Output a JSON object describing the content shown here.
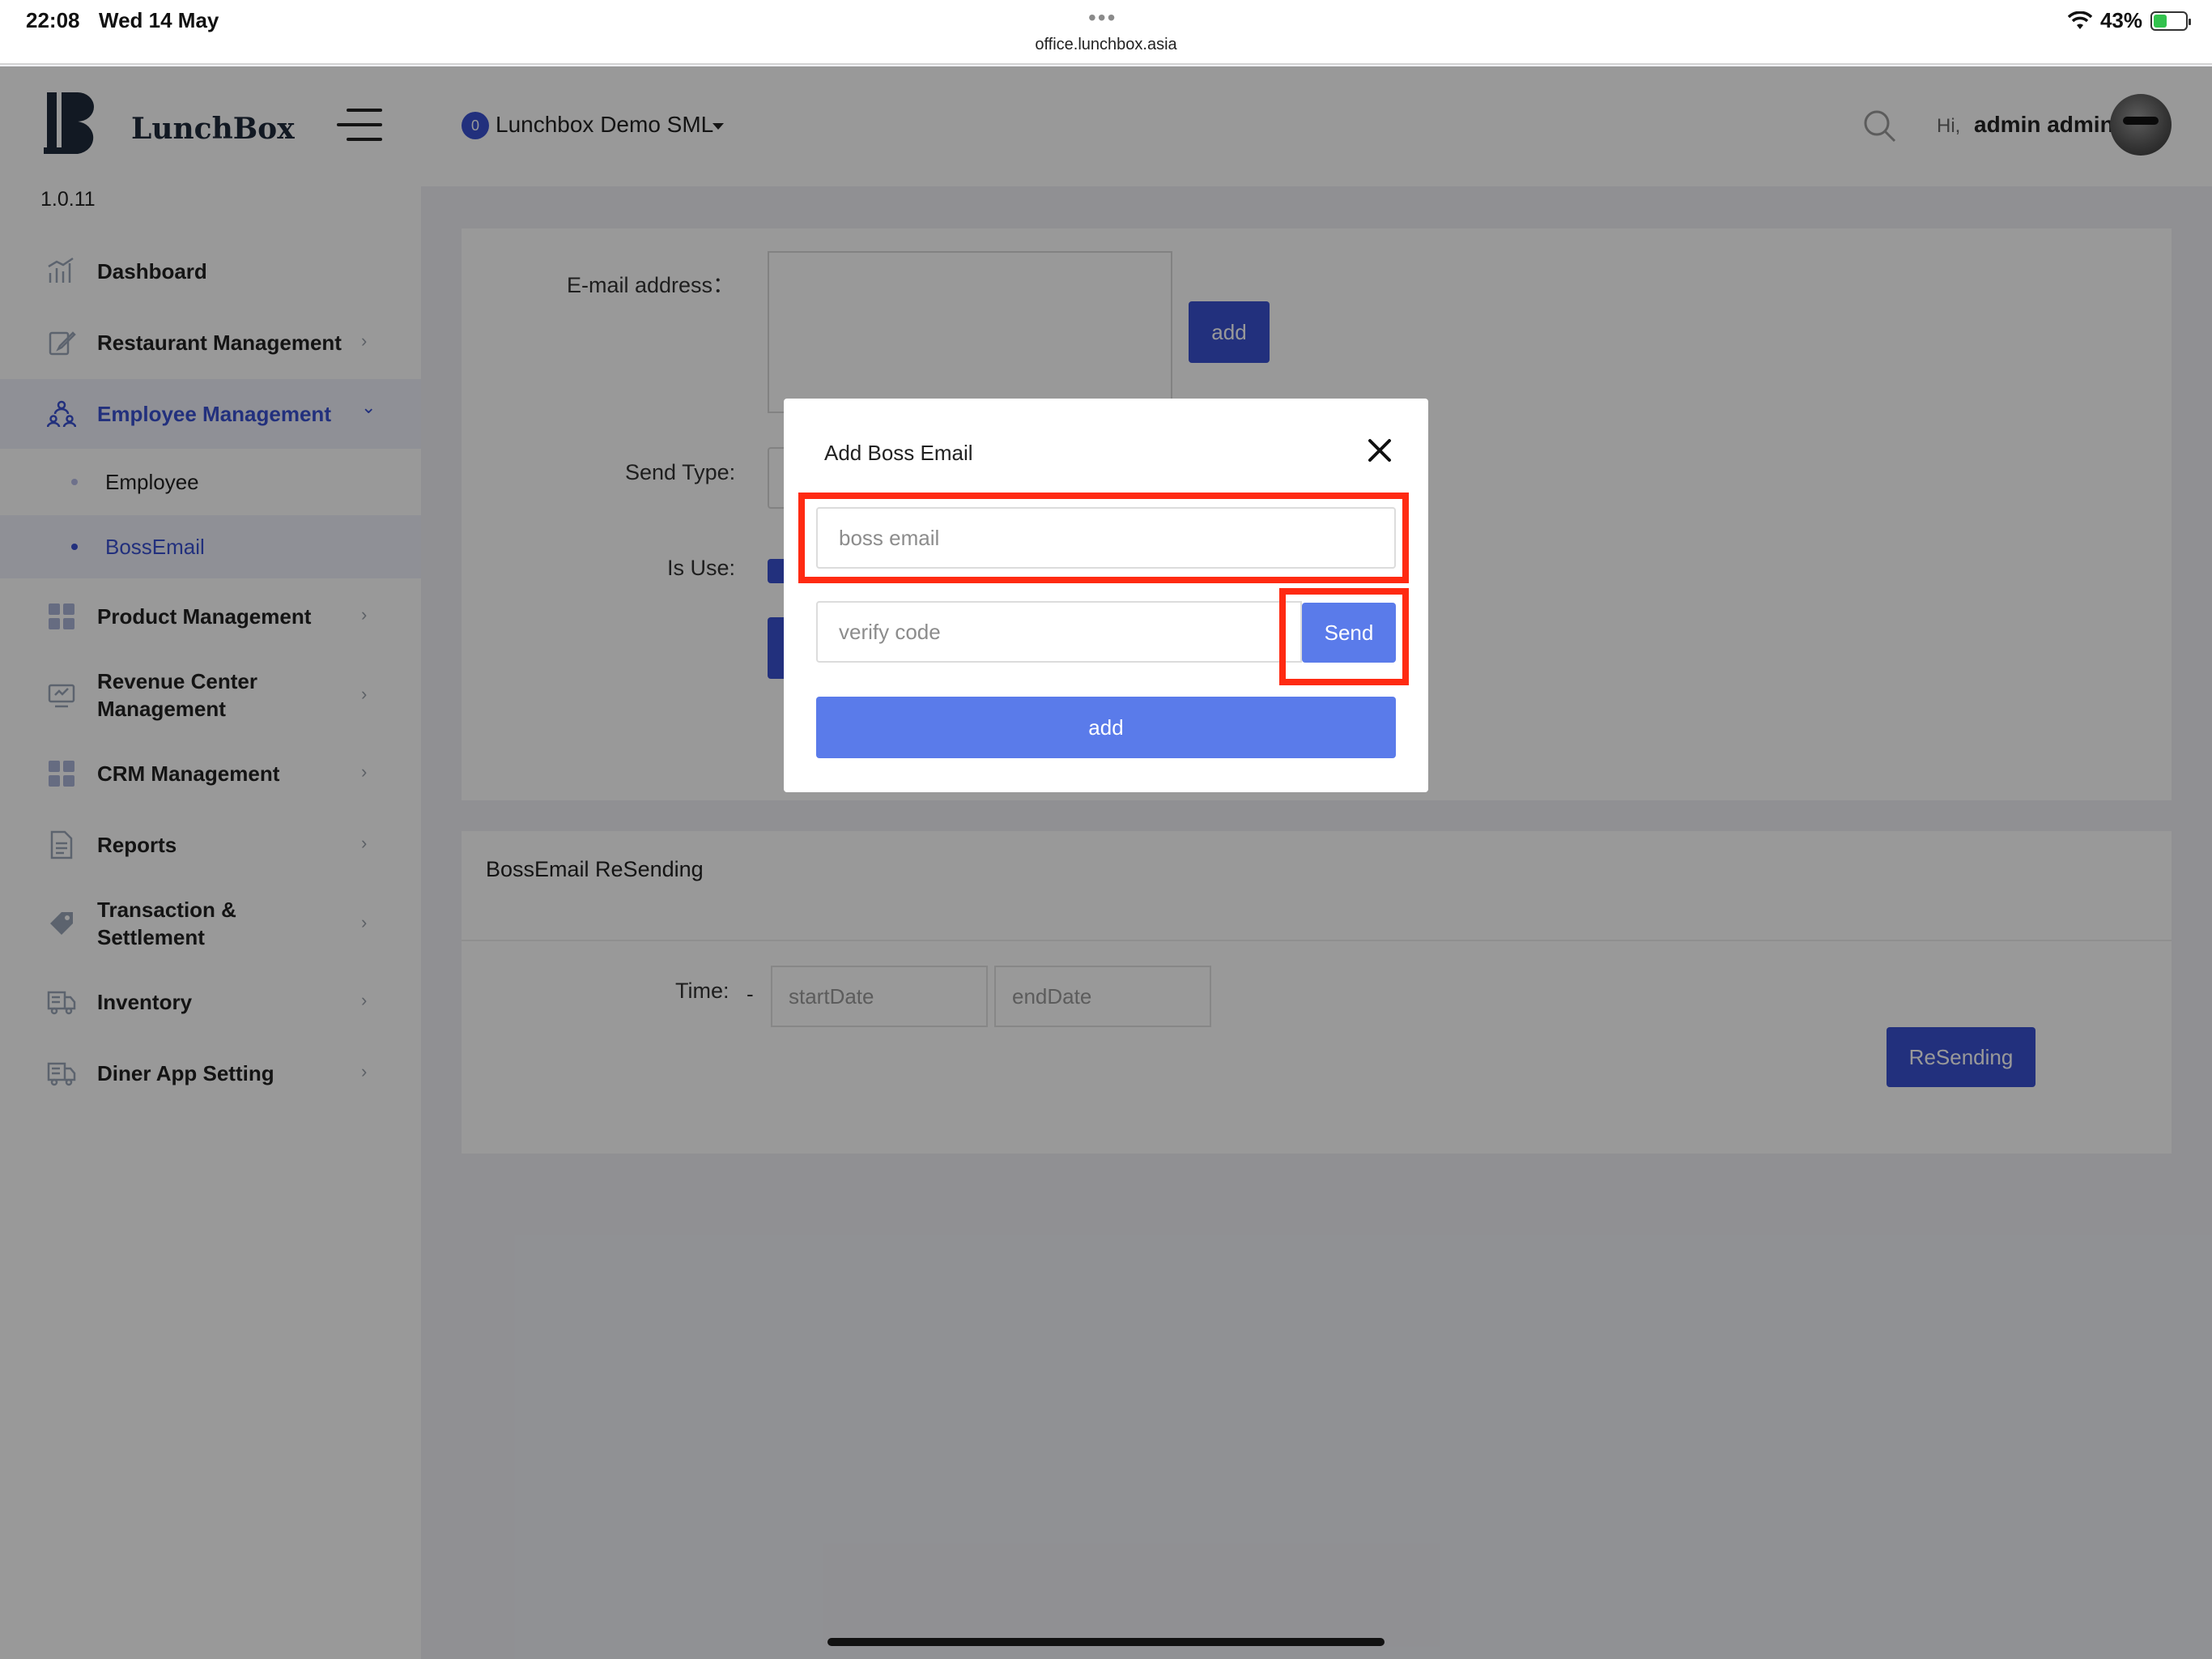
{
  "status_bar": {
    "time": "22:08",
    "date": "Wed 14 May",
    "dots": "•••",
    "url": "office.lunchbox.asia",
    "battery": "43%",
    "battery_level": 0.43
  },
  "sidebar": {
    "logo_text": "LunchBox",
    "version": "1.0.11",
    "items": [
      {
        "label": "Dashboard",
        "icon": "chart-bars-icon",
        "chevron": ""
      },
      {
        "label": "Restaurant Management",
        "icon": "edit-icon",
        "chevron": "›"
      },
      {
        "label": "Employee Management",
        "icon": "people-icon",
        "chevron": "⌄"
      },
      {
        "label": "Product Management",
        "icon": "grid-icon",
        "chevron": "›"
      },
      {
        "label": "Revenue Center Management",
        "icon": "monitor-icon",
        "chevron": "›"
      },
      {
        "label": "CRM Management",
        "icon": "grid-icon",
        "chevron": "›"
      },
      {
        "label": "Reports",
        "icon": "document-icon",
        "chevron": "›"
      },
      {
        "label": "Transaction & Settlement",
        "icon": "tag-icon",
        "chevron": "›"
      },
      {
        "label": "Inventory",
        "icon": "truck-icon",
        "chevron": "›"
      },
      {
        "label": "Diner App Setting",
        "icon": "truck-icon",
        "chevron": "›"
      }
    ],
    "sub_items": [
      {
        "label": "Employee"
      },
      {
        "label": "BossEmail"
      }
    ]
  },
  "header": {
    "store_badge": "0",
    "store_name": "Lunchbox Demo SML",
    "greeting": "Hi,",
    "user_name": "admin admin"
  },
  "form": {
    "email_label": "E-mail address：",
    "add_label": "add",
    "send_type_label": "Send Type:",
    "is_use_label": "Is Use:"
  },
  "resend": {
    "title": "BossEmail ReSending",
    "time_label": "Time:",
    "dash": "-",
    "start_placeholder": "startDate",
    "end_placeholder": "endDate",
    "button_label": "ReSending"
  },
  "modal": {
    "title": "Add Boss Email",
    "email_placeholder": "boss email",
    "code_placeholder": "verify code",
    "send_label": "Send",
    "add_label": "add"
  },
  "colors": {
    "primary": "#3a50d0",
    "modal_button": "#5a7bea",
    "highlight": "#ff2a12"
  }
}
